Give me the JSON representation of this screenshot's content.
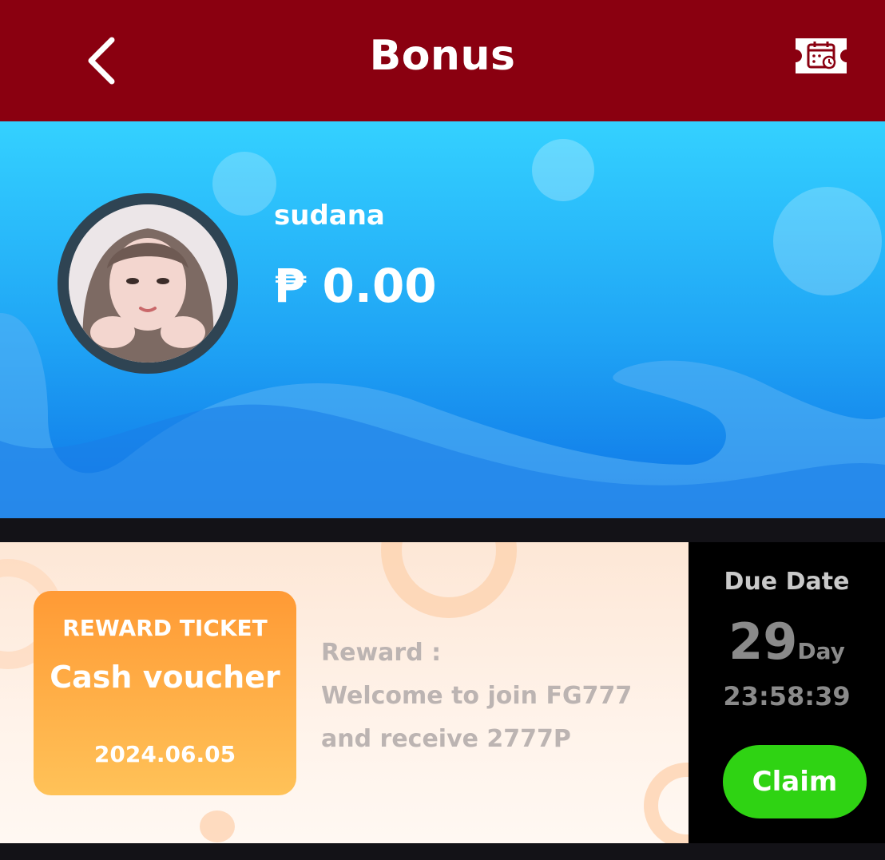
{
  "header": {
    "title": "Bonus",
    "back_icon": "chevron-left-icon",
    "calendar_icon": "calendar-ticket-icon",
    "background_color": "#8a0010"
  },
  "profile": {
    "username": "sudana",
    "balance": "₱ 0.00"
  },
  "ticket": {
    "label": "REWARD TICKET",
    "name": "Cash voucher",
    "date": "2024.06.05",
    "reward_title": "Reward :",
    "reward_desc": "Welcome to join FG777 and receive 2777P"
  },
  "due": {
    "title": "Due Date",
    "days": "29",
    "day_unit": "Day",
    "time": "23:58:39",
    "claim_label": "Claim",
    "claim_color": "#2fd313"
  }
}
